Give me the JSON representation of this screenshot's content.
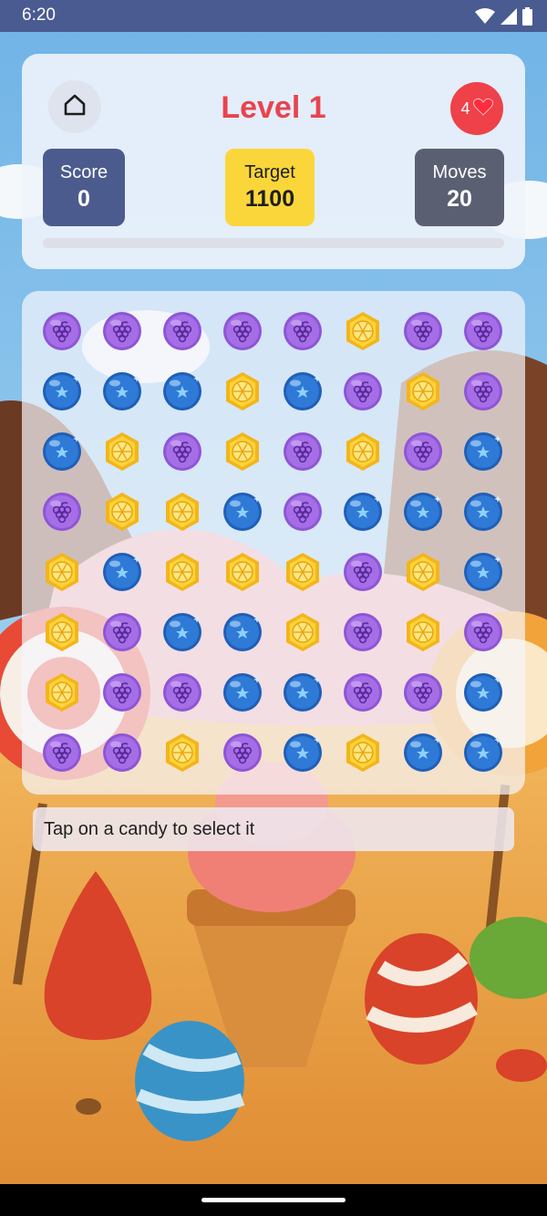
{
  "status_bar": {
    "time": "6:20",
    "icons": [
      "wifi-icon",
      "signal-icon",
      "battery-icon"
    ]
  },
  "header": {
    "home_icon": "home-icon",
    "level_title": "Level 1",
    "lives": {
      "count": "4",
      "icon": "heart-icon"
    },
    "score": {
      "label": "Score",
      "value": "0"
    },
    "target": {
      "label": "Target",
      "value": "1100"
    },
    "moves": {
      "label": "Moves",
      "value": "20"
    },
    "progress": 0
  },
  "board": {
    "rows": 8,
    "cols": 8,
    "grid": [
      [
        "grape",
        "grape",
        "grape",
        "grape",
        "grape",
        "lemon",
        "grape",
        "grape"
      ],
      [
        "blueberry",
        "blueberry",
        "blueberry",
        "lemon",
        "blueberry",
        "grape",
        "lemon",
        "grape"
      ],
      [
        "blueberry",
        "lemon",
        "grape",
        "lemon",
        "grape",
        "lemon",
        "grape",
        "blueberry"
      ],
      [
        "grape",
        "lemon",
        "lemon",
        "blueberry",
        "grape",
        "blueberry",
        "blueberry",
        "blueberry"
      ],
      [
        "lemon",
        "blueberry",
        "lemon",
        "lemon",
        "lemon",
        "grape",
        "lemon",
        "blueberry"
      ],
      [
        "lemon",
        "grape",
        "blueberry",
        "blueberry",
        "lemon",
        "grape",
        "lemon",
        "grape"
      ],
      [
        "lemon",
        "grape",
        "grape",
        "blueberry",
        "blueberry",
        "grape",
        "grape",
        "blueberry"
      ],
      [
        "grape",
        "grape",
        "lemon",
        "grape",
        "blueberry",
        "lemon",
        "blueberry",
        "blueberry"
      ]
    ]
  },
  "message": "Tap on a candy to select it",
  "colors": {
    "level_title": "#e8444f",
    "score_box": "#4c5b8e",
    "target_box": "#fbd63a",
    "moves_box": "#5a6072",
    "lives_badge": "#ee4149"
  }
}
